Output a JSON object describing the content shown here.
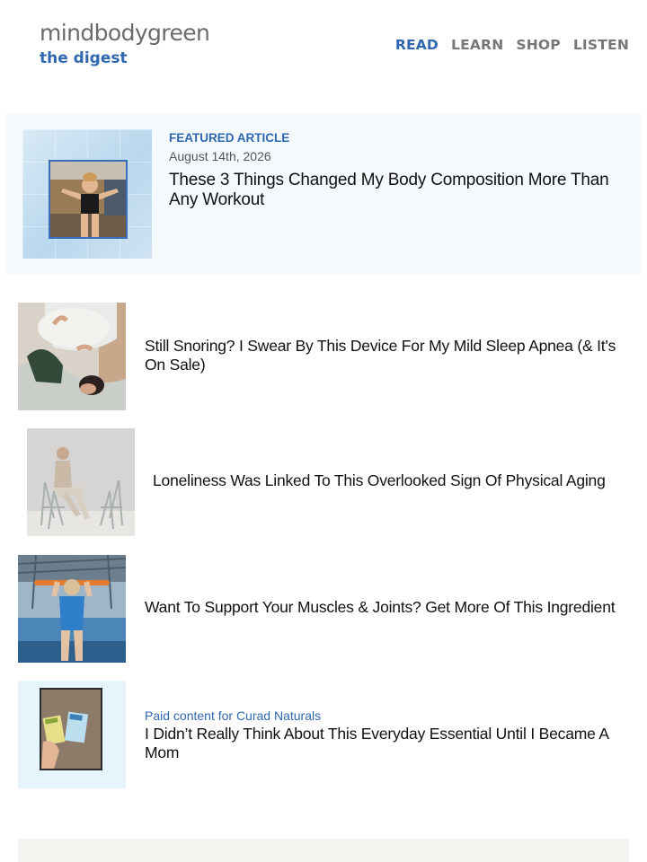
{
  "brand": {
    "name": "mindbodygreen",
    "sub": "the digest"
  },
  "nav": [
    "READ",
    "LEARN",
    "SHOP",
    "LISTEN"
  ],
  "featured": {
    "kicker": "FEATURED ARTICLE",
    "date": "August 14th, 2026",
    "title": "These 3 Things Changed My Body Composition More Than Any Workout"
  },
  "articles": [
    {
      "title": "Still Snoring? I Swear By This Device For My Mild Sleep Apnea (& It's On Sale)"
    },
    {
      "title": "Loneliness Was Linked To This Overlooked Sign Of Physical Aging"
    },
    {
      "title": "Want To Support Your Muscles & Joints? Get More Of This Ingredient"
    },
    {
      "sponsor": "Paid content for Curad Naturals",
      "title": "I Didn’t Really Think About This Everyday Essential Until I Became A Mom"
    }
  ],
  "colors": {
    "accent": "#2f67b0",
    "featured_bg": "#f3f9fc",
    "nav_inactive": "#777777"
  }
}
